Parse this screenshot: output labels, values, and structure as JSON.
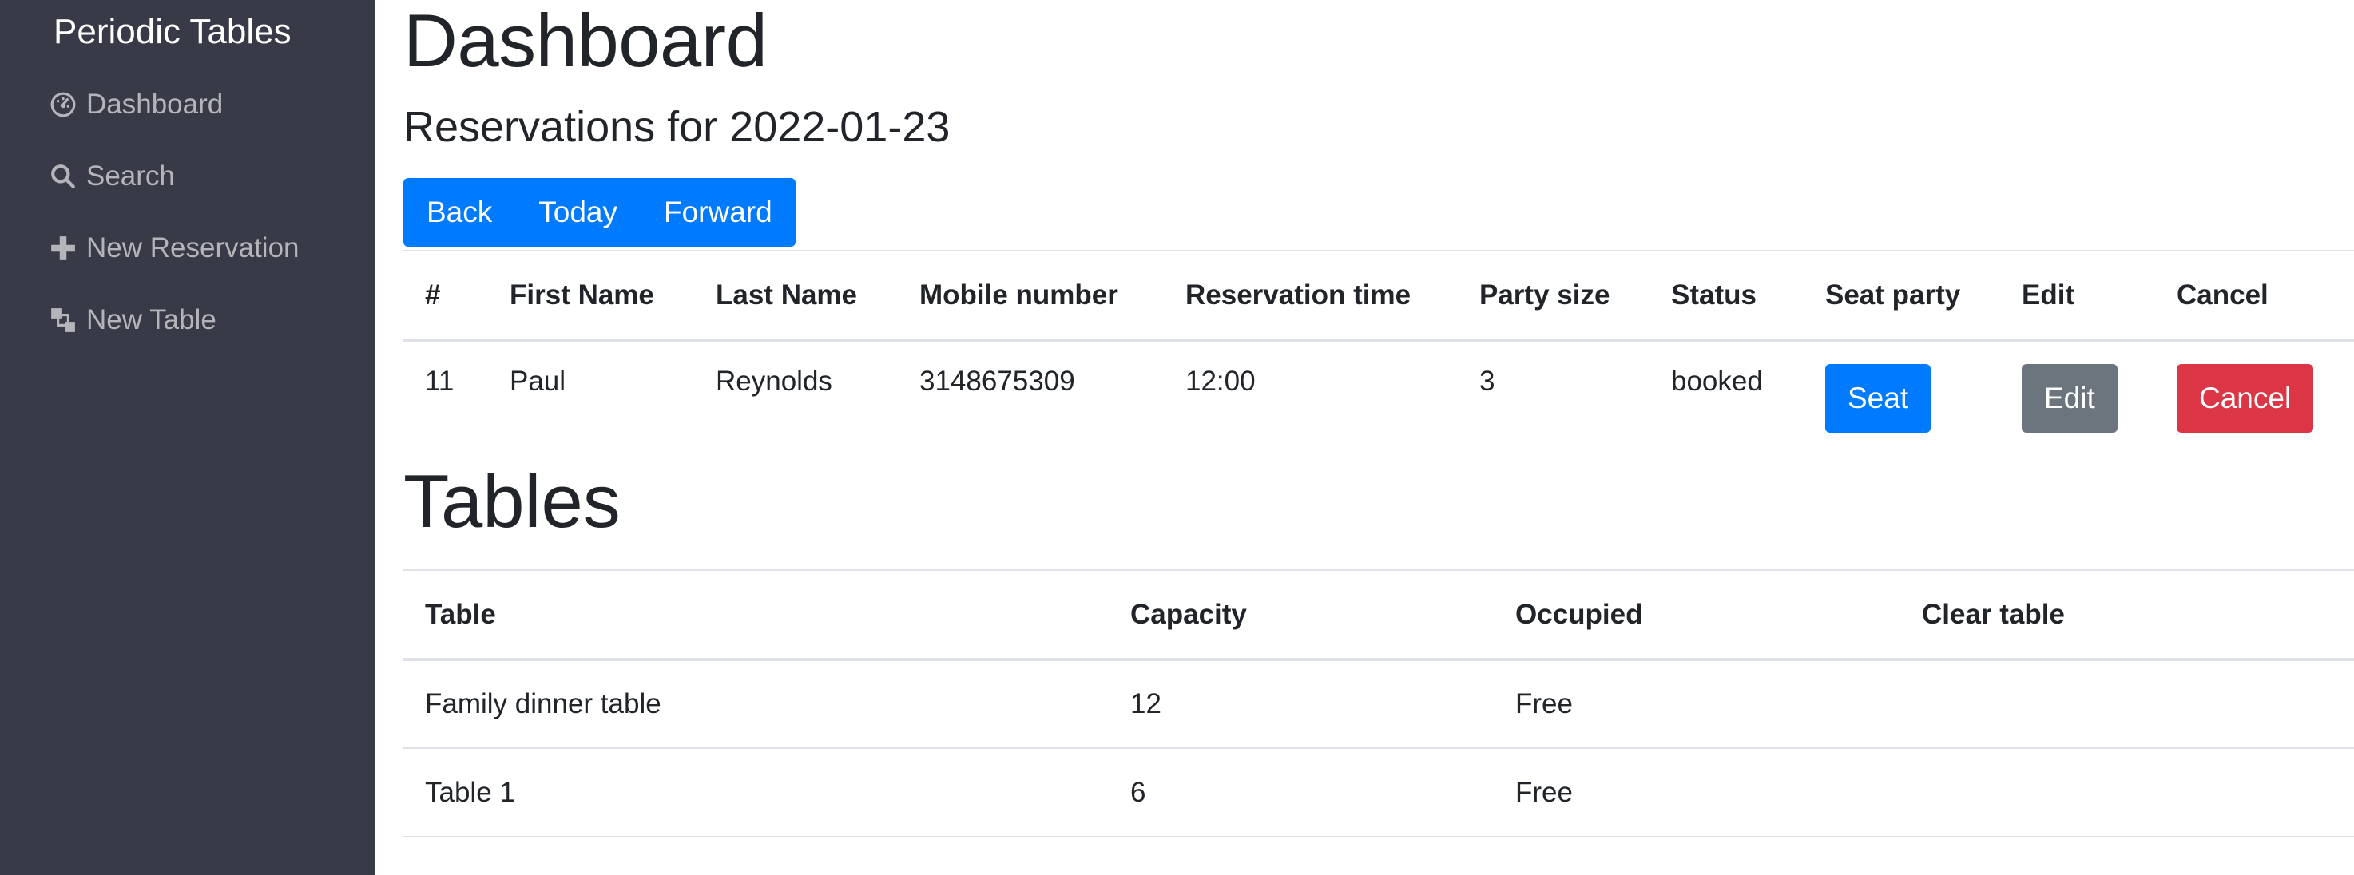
{
  "sidebar": {
    "brand": "Periodic Tables",
    "items": [
      {
        "label": "Dashboard",
        "icon": "dashboard-icon"
      },
      {
        "label": "Search",
        "icon": "search-icon"
      },
      {
        "label": "New Reservation",
        "icon": "plus-icon"
      },
      {
        "label": "New Table",
        "icon": "table-icon"
      }
    ]
  },
  "main": {
    "title": "Dashboard",
    "subtitle": "Reservations for 2022-01-23",
    "nav_buttons": {
      "back": "Back",
      "today": "Today",
      "forward": "Forward"
    },
    "reservations": {
      "headers": [
        "#",
        "First Name",
        "Last Name",
        "Mobile number",
        "Reservation time",
        "Party size",
        "Status",
        "Seat party",
        "Edit",
        "Cancel"
      ],
      "rows": [
        {
          "id": "11",
          "first_name": "Paul",
          "last_name": "Reynolds",
          "mobile": "3148675309",
          "time": "12:00",
          "party_size": "3",
          "status": "booked",
          "seat_label": "Seat",
          "edit_label": "Edit",
          "cancel_label": "Cancel"
        }
      ]
    },
    "tables_title": "Tables",
    "tables": {
      "headers": [
        "Table",
        "Capacity",
        "Occupied",
        "Clear table"
      ],
      "rows": [
        {
          "name": "Family dinner table",
          "capacity": "12",
          "occupied": "Free"
        },
        {
          "name": "Table 1",
          "capacity": "6",
          "occupied": "Free"
        }
      ]
    }
  },
  "colors": {
    "sidebar_bg": "#383b47",
    "primary": "#007bff",
    "secondary": "#6c757d",
    "danger": "#dc3545"
  }
}
